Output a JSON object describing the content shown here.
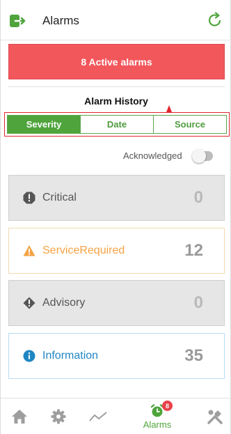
{
  "header": {
    "title": "Alarms",
    "logout_icon": "logout-icon",
    "refresh_icon": "refresh-icon"
  },
  "banner": {
    "text": "8 Active alarms",
    "color": "#f2575c"
  },
  "history": {
    "title": "Alarm History",
    "tabs": [
      {
        "label": "Severity",
        "selected": true
      },
      {
        "label": "Date",
        "selected": false
      },
      {
        "label": "Source",
        "selected": false
      }
    ]
  },
  "acknowledged": {
    "label": "Acknowledged",
    "enabled": false
  },
  "alarms": [
    {
      "label": "Critical",
      "count": "0",
      "icon": "critical-icon",
      "color": "#555555"
    },
    {
      "label": "ServiceRequired",
      "count": "12",
      "icon": "warning-icon",
      "color": "#f5a243"
    },
    {
      "label": "Advisory",
      "count": "0",
      "icon": "advisory-icon",
      "color": "#555555"
    },
    {
      "label": "Information",
      "count": "35",
      "icon": "info-icon",
      "color": "#1f86c4"
    }
  ],
  "nav": {
    "items": [
      {
        "icon": "home-icon"
      },
      {
        "icon": "gear-icon"
      },
      {
        "icon": "trend-icon"
      },
      {
        "icon": "alarm-clock-icon",
        "label": "Alarms",
        "badge": "8",
        "active": true
      },
      {
        "icon": "tools-icon"
      }
    ]
  },
  "colors": {
    "accent_green": "#4fa43c",
    "alert_red": "#e8424a"
  }
}
